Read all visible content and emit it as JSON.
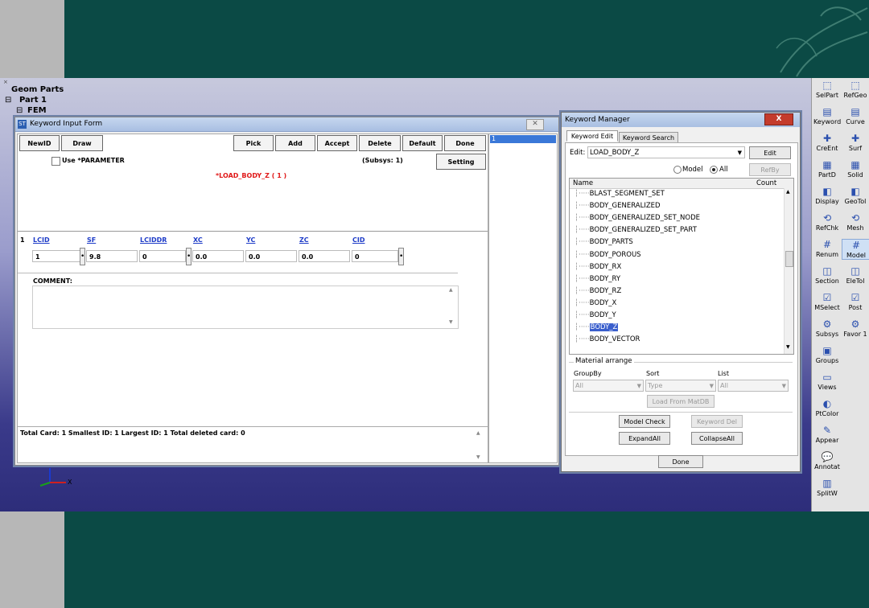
{
  "tree": {
    "items": [
      "Geom Parts",
      "Part 1",
      "FEM"
    ]
  },
  "toolbar": {
    "left_column": [
      "SelPart",
      "Keyword",
      "CreEnt",
      "PartD",
      "Display",
      "RefChk",
      "Renum",
      "Section",
      "MSelect",
      "Subsys",
      "Groups",
      "Views",
      "PtColor",
      "Appear",
      "Annotat",
      "SplitW"
    ],
    "right_column": [
      "RefGeo",
      "Curve",
      "Surf",
      "Solid",
      "GeoTol",
      "Mesh",
      "Model",
      "EleTol",
      "Post",
      "Favor 1"
    ],
    "selected": "Model"
  },
  "keyword_form": {
    "title": "Keyword Input Form",
    "buttons": {
      "newid": "NewID",
      "draw": "Draw",
      "pick": "Pick",
      "add": "Add",
      "accept": "Accept",
      "delete": "Delete",
      "default": "Default",
      "done": "Done",
      "setting": "Setting"
    },
    "use_parameter_label": "Use *PARAMETER",
    "subsys": "(Subsys: 1)",
    "keyword_heading": "*LOAD_BODY_Z  ( 1 )",
    "card_number": "1",
    "field_labels": [
      "LCID",
      "SF",
      "LCIDDR",
      "XC",
      "YC",
      "ZC",
      "CID"
    ],
    "field_values": [
      "1",
      "9.8",
      "0",
      "0.0",
      "0.0",
      "0.0",
      "0"
    ],
    "comment_label": "COMMENT:",
    "status": "Total Card: 1    Smallest ID: 1   Largest ID: 1    Total deleted card:  0",
    "list_item": "1"
  },
  "keyword_manager": {
    "title": "Keyword Manager",
    "close": "X",
    "tabs": [
      "Keyword Edit",
      "Keyword Search"
    ],
    "edit_label": "Edit:",
    "edit_value": "LOAD_BODY_Z",
    "edit_button": "Edit",
    "radio_model": "Model",
    "radio_all": "All",
    "refby_button": "RefBy",
    "col_name": "Name",
    "col_count": "Count",
    "keywords": [
      "BLAST_SEGMENT_SET",
      "BODY_GENERALIZED",
      "BODY_GENERALIZED_SET_NODE",
      "BODY_GENERALIZED_SET_PART",
      "BODY_PARTS",
      "BODY_POROUS",
      "BODY_RX",
      "BODY_RY",
      "BODY_RZ",
      "BODY_X",
      "BODY_Y",
      "BODY_Z",
      "BODY_VECTOR"
    ],
    "selected_keyword": "BODY_Z",
    "material_arrange": "Material arrange",
    "groupby_label": "GroupBy",
    "sort_label": "Sort",
    "list_label": "List",
    "groupby_value": "All",
    "sort_value": "Type",
    "list_value": "All",
    "load_matdb": "Load From MatDB",
    "model_check": "Model Check",
    "keyword_del": "Keyword Del",
    "expand_all": "ExpandAll",
    "collapse_all": "CollapseAll",
    "done": "Done"
  },
  "axes": {
    "x": "X",
    "y": "Y",
    "z": "Z"
  }
}
